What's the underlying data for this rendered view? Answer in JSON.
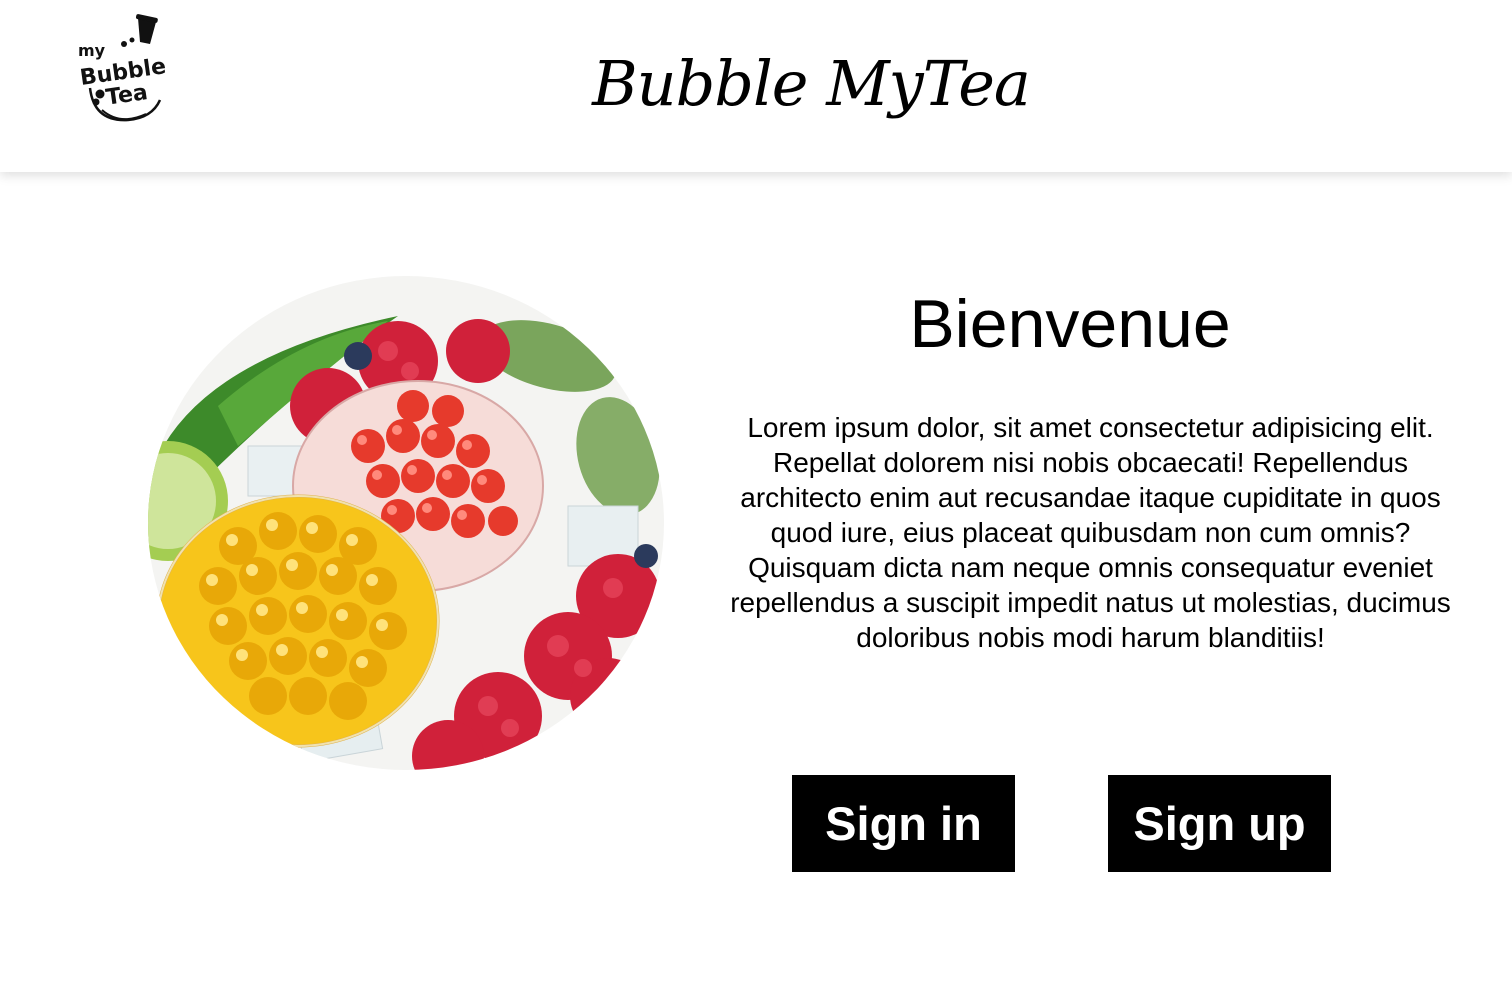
{
  "header": {
    "logo_text": [
      "my",
      "Bubble",
      "Tea"
    ],
    "title": "Bubble MyTea"
  },
  "hero": {
    "image_description_icon": "bubble-tea-fruit-photo"
  },
  "welcome": {
    "title": "Bienvenue",
    "text": "Lorem ipsum dolor, sit amet consectetur adipisicing elit. Repellat dolorem nisi nobis obcaecati! Repellendus architecto enim aut recusandae itaque cupiditate in quos quod iure, eius placeat quibusdam non cum omnis? Quisquam dicta nam neque omnis consequatur eveniet repellendus a suscipit impedit natus ut molestias, ducimus doloribus nobis modi harum blanditiis!"
  },
  "buttons": {
    "sign_in": "Sign in",
    "sign_up": "Sign up"
  },
  "colors": {
    "background": "#ffffff",
    "button_bg": "#000000",
    "button_text": "#ffffff"
  }
}
